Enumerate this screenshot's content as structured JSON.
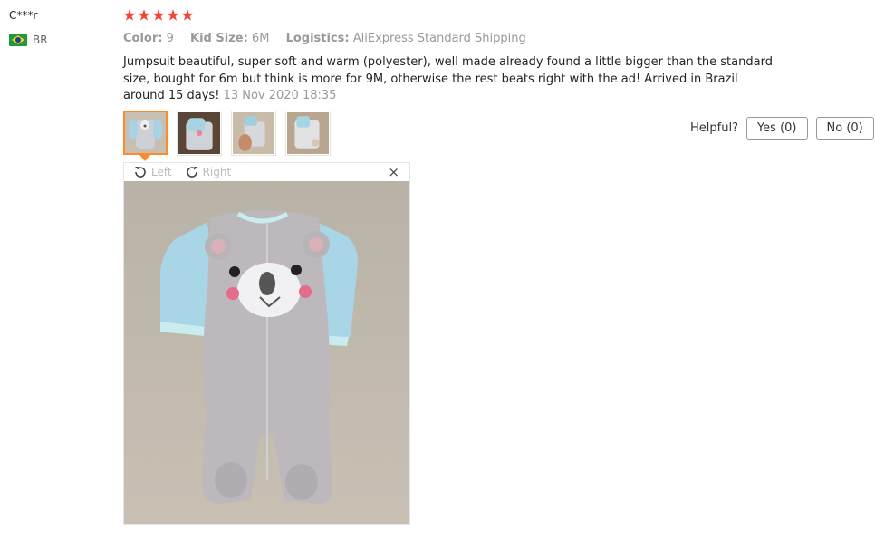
{
  "review": {
    "user": "C***r",
    "country": "BR",
    "rating": 5,
    "attributes": [
      {
        "key": "Color:",
        "value": "9"
      },
      {
        "key": "Kid Size:",
        "value": "6M"
      },
      {
        "key": "Logistics:",
        "value": "AliExpress Standard Shipping"
      }
    ],
    "text": "Jumpsuit beautiful, super soft and warm (polyester), well made already found a little bigger than the standard size, bought for 6m but think is more for 9M, otherwise the rest beats right with the ad! Arrived in Brazil around 15 days!",
    "date": "13 Nov 2020 18:35"
  },
  "helpful": {
    "label": "Helpful?",
    "yes": "Yes (0)",
    "no": "No (0)"
  },
  "viewer": {
    "left": "Left",
    "right": "Right",
    "close": "×"
  },
  "icons": {
    "star": "star-icon",
    "rotate_left": "rotate-left-icon",
    "rotate_right": "rotate-right-icon",
    "close": "close-icon",
    "flag": "brazil-flag-icon"
  },
  "colors": {
    "star": "#f44336",
    "active_thumb": "#ff8a2a",
    "muted_text": "#999999"
  }
}
